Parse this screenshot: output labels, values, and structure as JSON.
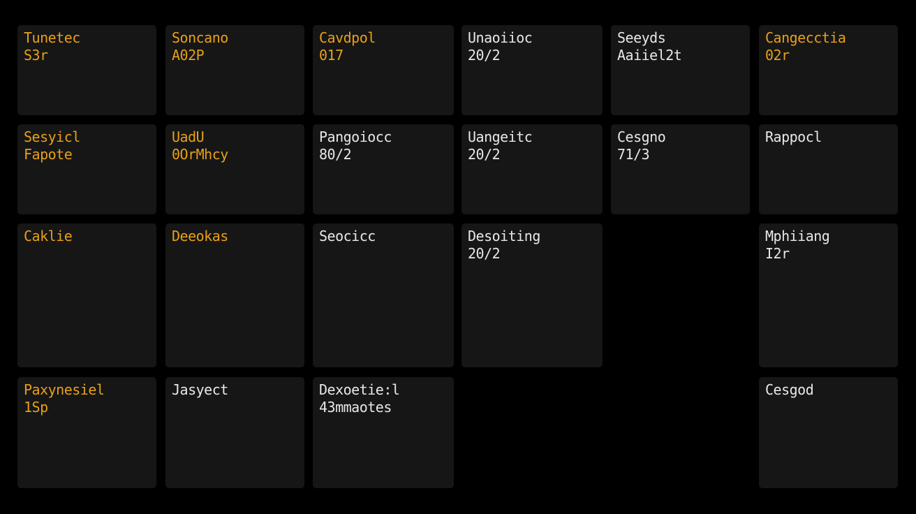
{
  "tiles": [
    {
      "color": "orange",
      "line1": "Tunetec",
      "line2": "S3r"
    },
    {
      "color": "orange",
      "line1": "Soncano",
      "line2": "A02P"
    },
    {
      "color": "orange",
      "line1": "Cavdpol",
      "line2": "017"
    },
    {
      "color": "white",
      "line1": "Unaoiioc",
      "line2": "20/2"
    },
    {
      "color": "white",
      "line1": "Seeyds",
      "line2": "Aaiiel2t"
    },
    {
      "color": "orange",
      "line1": "Cangecctia",
      "line2": "02r"
    },
    {
      "color": "orange",
      "line1": "Sesyicl",
      "line2": "Fapote"
    },
    {
      "color": "orange",
      "line1": "UadU",
      "line2": "0OrMhcy"
    },
    {
      "color": "white",
      "line1": "Pangoiocc",
      "line2": "80/2"
    },
    {
      "color": "white",
      "line1": "Uangeitc",
      "line2": "20/2"
    },
    {
      "color": "white",
      "line1": "Cesgno",
      "line2": "71/3"
    },
    {
      "color": "white",
      "line1": "Rappocl",
      "line2": ""
    },
    {
      "color": "orange",
      "line1": "Caklie",
      "line2": ""
    },
    {
      "color": "orange",
      "line1": "Deeokas",
      "line2": ""
    },
    {
      "color": "white",
      "line1": "Seocicc",
      "line2": ""
    },
    {
      "color": "white",
      "line1": "Desoiting",
      "line2": "20/2"
    },
    {
      "color": "white",
      "line1": "Mphiiang",
      "line2": "I2r"
    },
    {
      "color": "orange",
      "line1": "Paxynesiel",
      "line2": "1Sp"
    },
    {
      "color": "white",
      "line1": "Jasyect",
      "line2": ""
    },
    {
      "color": "white",
      "line1": "Dexoetie:l",
      "line2": "43mmaotes"
    },
    {
      "color": "white",
      "line1": "Cesgod",
      "line2": ""
    }
  ]
}
